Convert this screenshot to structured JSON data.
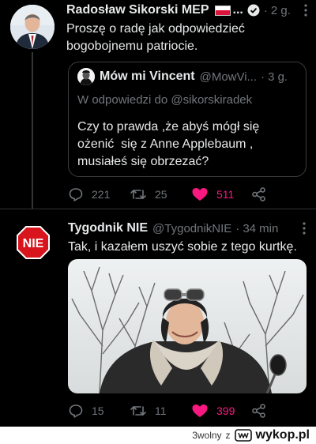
{
  "tweet1": {
    "author_name": "Radosław Sikorski MEP",
    "time": "2 g.",
    "text_line1": "Proszę o radę jak odpowiedzieć",
    "text_line2": "bogobojnemu patriocie.",
    "quote": {
      "author_name": "Mów mi Vincent",
      "handle": "@MowVi...",
      "time": "3 g.",
      "reply_to": "W odpowiedzi do @sikorskiradek",
      "text_line1": "Czy to prawda ,że abyś mógł się",
      "text_line2": "ożenić  się z Anne Applebaum ,",
      "text_line3": "musiałeś się obrzezać?"
    },
    "replies": "221",
    "retweets": "25",
    "likes": "511"
  },
  "tweet2": {
    "author_name": "Tygodnik NIE",
    "handle": "@TygodnikNIE",
    "time": "34 min",
    "avatar_text": "NIE",
    "text": "Tak, i kazałem uszyć sobie z tego kurtkę.",
    "replies": "15",
    "retweets": "11",
    "likes": "399"
  },
  "footer": {
    "username": "3wolny",
    "separator": "z",
    "site": "wykop.pl"
  },
  "colors": {
    "like_red": "#f91880",
    "nie_red": "#d8141c",
    "muted": "#71767b"
  }
}
